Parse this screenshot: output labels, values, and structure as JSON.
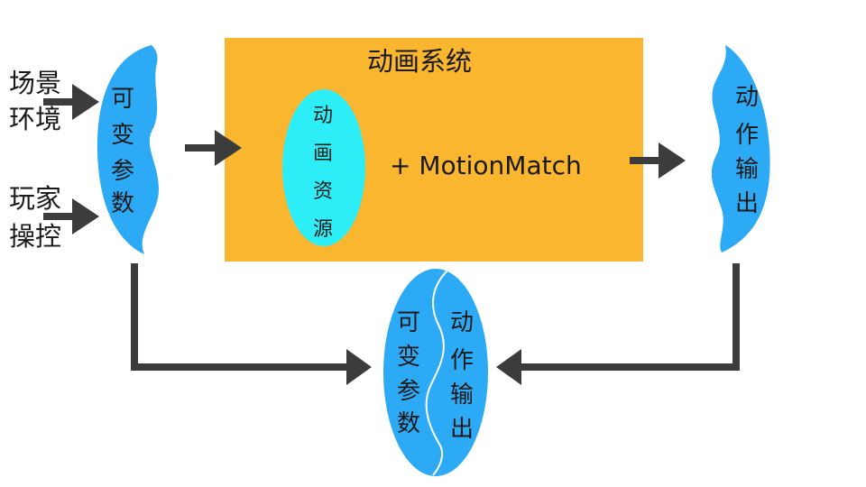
{
  "colors": {
    "system_box": "#F9B62E",
    "blue_shape": "#2DAAF5",
    "cyan_ellipse": "#2DEEF7",
    "arrow": "#3C3C3C",
    "text": "#1A1A1A"
  },
  "inputs": {
    "scene_line1": "场景",
    "scene_line2": "环境",
    "player_line1": "玩家",
    "player_line2": "操控"
  },
  "variable_params": {
    "c1": "可",
    "c2": "变",
    "c3": "参",
    "c4": "数"
  },
  "system": {
    "title": "动画系统",
    "resource": {
      "c1": "动",
      "c2": "画",
      "c3": "资",
      "c4": "源"
    },
    "motion_match": "+ MotionMatch"
  },
  "action_output": {
    "c1": "动",
    "c2": "作",
    "c3": "输",
    "c4": "出"
  },
  "combined": {
    "left": {
      "c1": "可",
      "c2": "变",
      "c3": "参",
      "c4": "数"
    },
    "right": {
      "c1": "动",
      "c2": "作",
      "c3": "输",
      "c4": "出"
    }
  }
}
